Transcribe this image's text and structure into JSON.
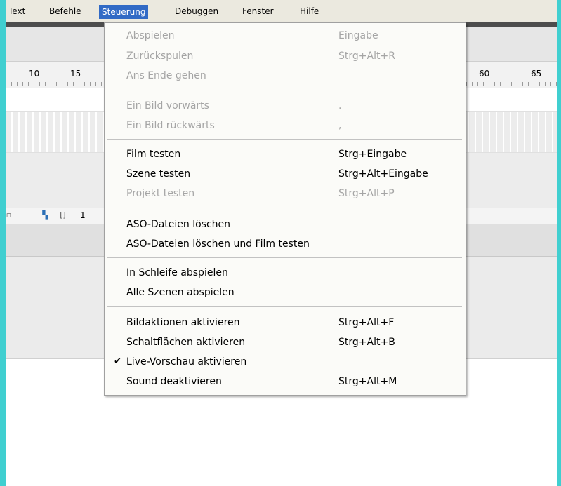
{
  "menubar": {
    "items": [
      {
        "label": "Text"
      },
      {
        "label": "Befehle"
      },
      {
        "label": "Steuerung"
      },
      {
        "label": "Debuggen"
      },
      {
        "label": "Fenster"
      },
      {
        "label": "Hilfe"
      }
    ],
    "active": "Steuerung"
  },
  "ruler": {
    "labels": [
      "10",
      "15",
      "60",
      "65"
    ]
  },
  "timeline_toolbar": {
    "frame_number": "1"
  },
  "dropdown": {
    "items": [
      {
        "label": "Abspielen",
        "shortcut": "Eingabe",
        "enabled": false
      },
      {
        "label": "Zurückspulen",
        "shortcut": "Strg+Alt+R",
        "enabled": false
      },
      {
        "label": "Ans Ende gehen",
        "shortcut": "",
        "enabled": false
      },
      {
        "label": "Ein Bild vorwärts",
        "shortcut": ".",
        "enabled": false
      },
      {
        "label": "Ein Bild rückwärts",
        "shortcut": ",",
        "enabled": false
      },
      {
        "label": "Film testen",
        "shortcut": "Strg+Eingabe",
        "enabled": true
      },
      {
        "label": "Szene testen",
        "shortcut": "Strg+Alt+Eingabe",
        "enabled": true
      },
      {
        "label": "Projekt testen",
        "shortcut": "Strg+Alt+P",
        "enabled": false
      },
      {
        "label": "ASO-Dateien löschen",
        "shortcut": "",
        "enabled": true
      },
      {
        "label": "ASO-Dateien löschen und Film testen",
        "shortcut": "",
        "enabled": true
      },
      {
        "label": "In Schleife abspielen",
        "shortcut": "",
        "enabled": true
      },
      {
        "label": "Alle Szenen abspielen",
        "shortcut": "",
        "enabled": true
      },
      {
        "label": "Bildaktionen aktivieren",
        "shortcut": "Strg+Alt+F",
        "enabled": true
      },
      {
        "label": "Schaltflächen aktivieren",
        "shortcut": "Strg+Alt+B",
        "enabled": true
      },
      {
        "label": "Live-Vorschau aktivieren",
        "shortcut": "",
        "enabled": true,
        "checked": true,
        "check_glyph": "✔"
      },
      {
        "label": "Sound deaktivieren",
        "shortcut": "Strg+Alt+M",
        "enabled": true
      }
    ]
  }
}
